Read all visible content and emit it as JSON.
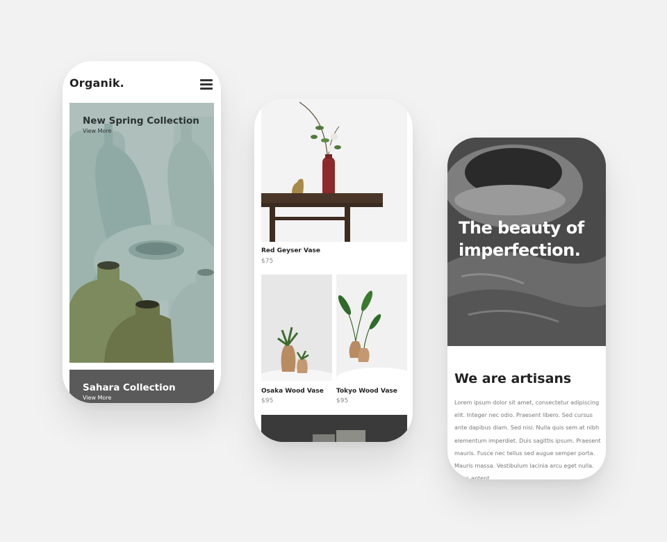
{
  "phone1": {
    "brand": "Organik.",
    "menu_icon": "hamburger-menu-icon",
    "hero": {
      "title": "New Spring Collection",
      "link": "View More"
    },
    "second": {
      "title": "Sahara Collection",
      "link": "View More"
    }
  },
  "phone2": {
    "products": [
      {
        "name": "Red Geyser Vase",
        "price": "$75"
      },
      {
        "name": "Osaka Wood Vase",
        "price": "$95"
      },
      {
        "name": "Tokyo Wood Vase",
        "price": "$95"
      }
    ]
  },
  "phone3": {
    "headline": "The beauty of imperfection.",
    "about_title": "We are artisans",
    "about_body": "Lorem ipsum dolor sit amet, consectetur adipiscing elit. Integer nec odio. Praesent libero. Sed cursus ante dapibus diam. Sed nisi. Nulla quis sem at nibh elementum imperdiet. Duis sagittis ipsum. Praesent mauris. Fusce nec tellus sed augue semper porta. Mauris massa. Vestibulum lacinia arcu eget nulla. Class aptent"
  },
  "colors": {
    "background": "#f2f2f2",
    "text_dark": "#222222",
    "text_muted": "#888888"
  }
}
